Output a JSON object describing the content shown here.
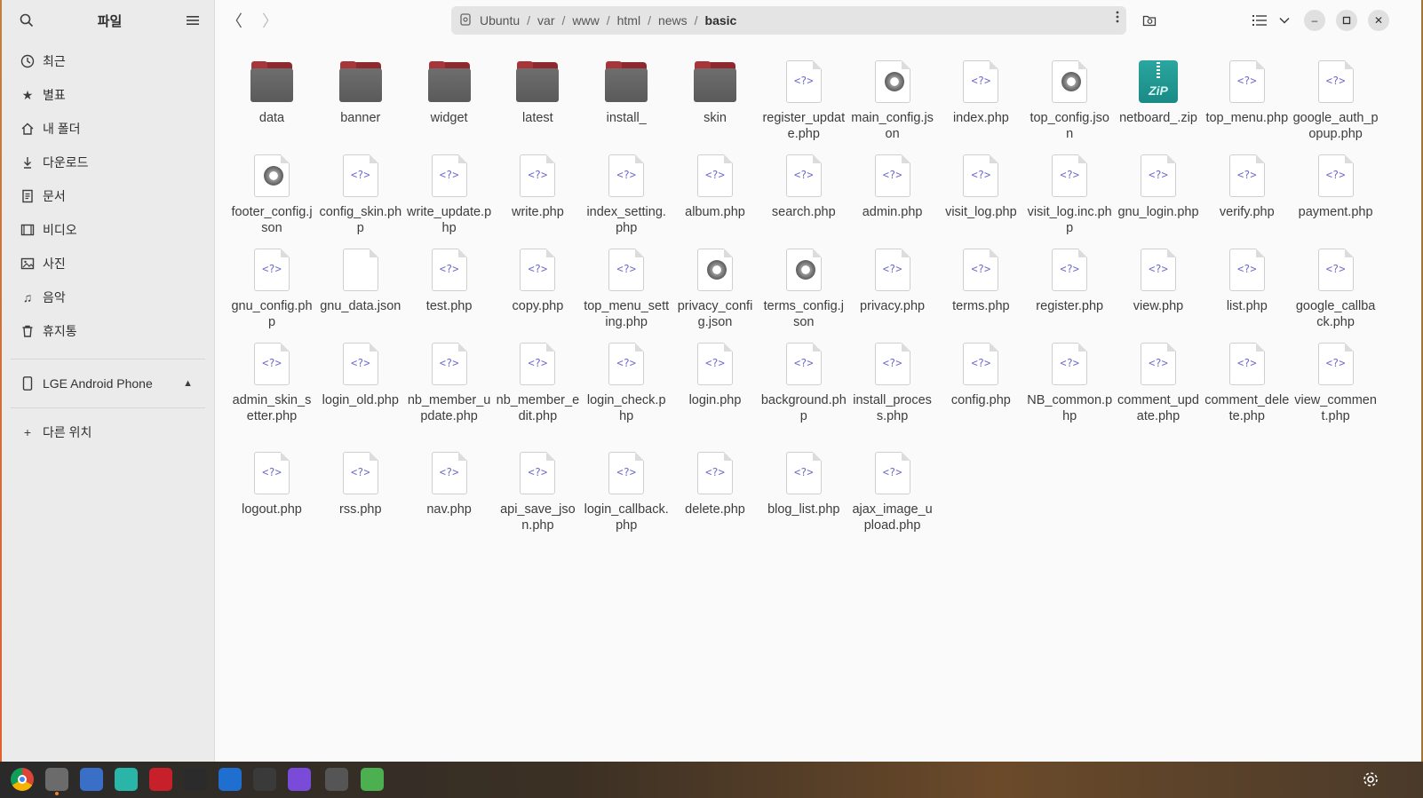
{
  "sidebar": {
    "title": "파일",
    "items": [
      {
        "label": "최근",
        "icon": "clock-icon"
      },
      {
        "label": "별표",
        "icon": "star-icon"
      },
      {
        "label": "내 폴더",
        "icon": "home-icon"
      },
      {
        "label": "다운로드",
        "icon": "download-icon"
      },
      {
        "label": "문서",
        "icon": "document-icon"
      },
      {
        "label": "비디오",
        "icon": "video-icon"
      },
      {
        "label": "사진",
        "icon": "photo-icon"
      },
      {
        "label": "음악",
        "icon": "music-icon"
      },
      {
        "label": "휴지통",
        "icon": "trash-icon"
      }
    ],
    "device": {
      "label": "LGE Android Phone",
      "icon": "phone-icon",
      "action_icon": "eject-icon"
    },
    "other_locations": {
      "label": "다른 위치",
      "icon": "plus-icon"
    }
  },
  "pathbar": {
    "crumbs": [
      "Ubuntu",
      "var",
      "www",
      "html",
      "news",
      "basic"
    ],
    "separator": "/"
  },
  "files": [
    {
      "name": "data",
      "type": "folder"
    },
    {
      "name": "banner",
      "type": "folder"
    },
    {
      "name": "widget",
      "type": "folder"
    },
    {
      "name": "latest",
      "type": "folder"
    },
    {
      "name": "install_",
      "type": "folder"
    },
    {
      "name": "skin",
      "type": "folder"
    },
    {
      "name": "register_update.php",
      "type": "php"
    },
    {
      "name": "main_config.json",
      "type": "json"
    },
    {
      "name": "index.php",
      "type": "php"
    },
    {
      "name": "top_config.json",
      "type": "json"
    },
    {
      "name": "netboard_.zip",
      "type": "zip"
    },
    {
      "name": "top_menu.php",
      "type": "php"
    },
    {
      "name": "google_auth_popup.php",
      "type": "php"
    },
    {
      "name": "footer_config.json",
      "type": "json"
    },
    {
      "name": "config_skin.php",
      "type": "php"
    },
    {
      "name": "write_update.php",
      "type": "php"
    },
    {
      "name": "write.php",
      "type": "php"
    },
    {
      "name": "index_setting.php",
      "type": "php"
    },
    {
      "name": "album.php",
      "type": "php"
    },
    {
      "name": "search.php",
      "type": "php"
    },
    {
      "name": "admin.php",
      "type": "php"
    },
    {
      "name": "visit_log.php",
      "type": "php"
    },
    {
      "name": "visit_log.inc.php",
      "type": "php"
    },
    {
      "name": "gnu_login.php",
      "type": "php"
    },
    {
      "name": "verify.php",
      "type": "php"
    },
    {
      "name": "payment.php",
      "type": "php"
    },
    {
      "name": "gnu_config.php",
      "type": "php"
    },
    {
      "name": "gnu_data.json",
      "type": "blank"
    },
    {
      "name": "test.php",
      "type": "php"
    },
    {
      "name": "copy.php",
      "type": "php"
    },
    {
      "name": "top_menu_setting.php",
      "type": "php"
    },
    {
      "name": "privacy_config.json",
      "type": "json"
    },
    {
      "name": "terms_config.json",
      "type": "json"
    },
    {
      "name": "privacy.php",
      "type": "php"
    },
    {
      "name": "terms.php",
      "type": "php"
    },
    {
      "name": "register.php",
      "type": "php"
    },
    {
      "name": "view.php",
      "type": "php"
    },
    {
      "name": "list.php",
      "type": "php"
    },
    {
      "name": "google_callback.php",
      "type": "php"
    },
    {
      "name": "admin_skin_setter.php",
      "type": "php"
    },
    {
      "name": "login_old.php",
      "type": "php"
    },
    {
      "name": "nb_member_update.php",
      "type": "php"
    },
    {
      "name": "nb_member_edit.php",
      "type": "php"
    },
    {
      "name": "login_check.php",
      "type": "php"
    },
    {
      "name": "login.php",
      "type": "php"
    },
    {
      "name": "background.php",
      "type": "php"
    },
    {
      "name": "install_process.php",
      "type": "php"
    },
    {
      "name": "config.php",
      "type": "php"
    },
    {
      "name": "NB_common.php",
      "type": "php"
    },
    {
      "name": "comment_update.php",
      "type": "php"
    },
    {
      "name": "comment_delete.php",
      "type": "php"
    },
    {
      "name": "view_comment.php",
      "type": "php"
    },
    {
      "name": "logout.php",
      "type": "php"
    },
    {
      "name": "rss.php",
      "type": "php"
    },
    {
      "name": "nav.php",
      "type": "php"
    },
    {
      "name": "api_save_json.php",
      "type": "php"
    },
    {
      "name": "login_callback.php",
      "type": "php"
    },
    {
      "name": "delete.php",
      "type": "php"
    },
    {
      "name": "blog_list.php",
      "type": "php"
    },
    {
      "name": "ajax_image_upload.php",
      "type": "php"
    }
  ],
  "icons": {
    "php_glyph": "<?>",
    "zip_label": "ZiP"
  },
  "taskbar": [
    {
      "name": "chrome-icon",
      "color": "#e8e8e8"
    },
    {
      "name": "files-icon",
      "color": "#6b6b6b"
    },
    {
      "name": "app-grid-icon",
      "color": "#3a6fc8"
    },
    {
      "name": "messenger-icon",
      "color": "#29b6a8"
    },
    {
      "name": "filezilla-icon",
      "color": "#c8202a"
    },
    {
      "name": "terminal-icon",
      "color": "#2b2b2b"
    },
    {
      "name": "vscode-icon",
      "color": "#1e6fcf"
    },
    {
      "name": "obs-icon",
      "color": "#3a3a3a"
    },
    {
      "name": "app-p-icon",
      "color": "#7a4ad8"
    },
    {
      "name": "phone-device-icon",
      "color": "#555555"
    },
    {
      "name": "recycle-icon",
      "color": "#4caf50"
    }
  ]
}
